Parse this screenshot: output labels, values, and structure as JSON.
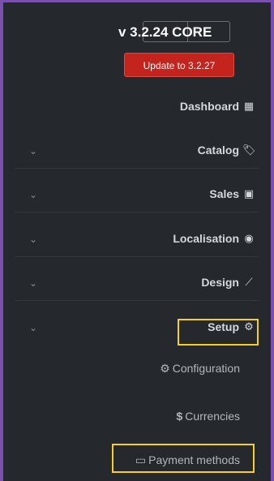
{
  "header": {
    "version_text": "v 3.2.24 CORE",
    "update_button": "Update to 3.2.27"
  },
  "menu": {
    "items": [
      {
        "label": "Dashboard",
        "icon": "dashboard-icon",
        "glyph": "▦"
      },
      {
        "label": "Catalog",
        "icon": "tags-icon",
        "glyph": "🏷"
      },
      {
        "label": "Sales",
        "icon": "money-icon",
        "glyph": "▣"
      },
      {
        "label": "Localisation",
        "icon": "globe-icon",
        "glyph": "◉"
      },
      {
        "label": "Design",
        "icon": "paint-brush-icon",
        "glyph": "⟋"
      },
      {
        "label": "Setup",
        "icon": "cogs-icon",
        "glyph": "⚙"
      }
    ],
    "setup_submenu": [
      {
        "label": "Configuration",
        "icon": "cogs-icon",
        "glyph": "⚙"
      },
      {
        "label": "Currencies",
        "icon": "dollar-icon",
        "glyph": "$"
      },
      {
        "label": "Payment methods",
        "icon": "credit-card-icon",
        "glyph": "▭"
      }
    ]
  },
  "highlight_color": "#f4d11e",
  "chevron": "⌄"
}
